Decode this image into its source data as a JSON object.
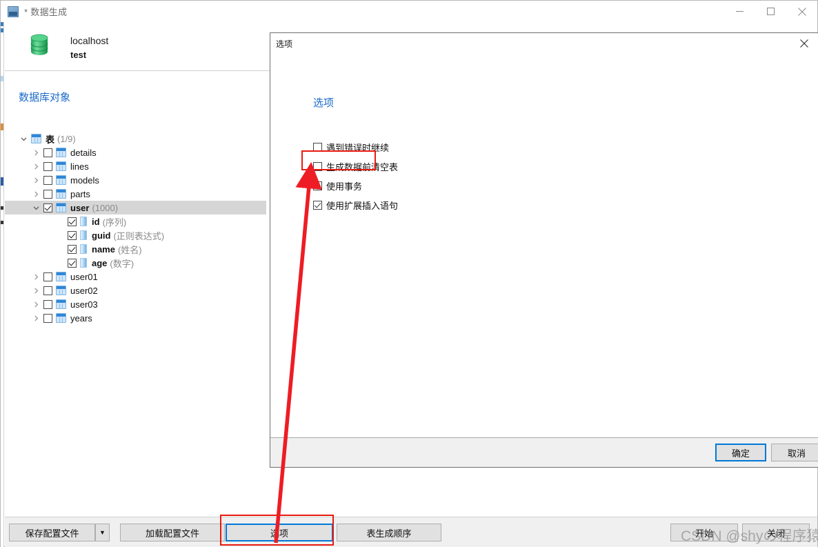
{
  "window": {
    "title": "* 数据生成",
    "icon": "database-generate-icon",
    "controls": {
      "minimize": "minimize-icon",
      "maximize": "maximize-icon",
      "close": "close-icon"
    }
  },
  "connection": {
    "host": "localhost",
    "database": "test",
    "icon": "database-cylinder-icon"
  },
  "objects_panel": {
    "title": "数据库对象",
    "tree": [
      {
        "label": "表",
        "meta": "(1/9)",
        "level": 0,
        "expander": "chevron-down",
        "checkbox": "none",
        "icon": "table-group-icon",
        "bold": true,
        "selected": false
      },
      {
        "label": "details",
        "meta": "",
        "level": 1,
        "expander": "chevron-right",
        "checkbox": "unchecked",
        "icon": "table-icon",
        "bold": false,
        "selected": false
      },
      {
        "label": "lines",
        "meta": "",
        "level": 1,
        "expander": "chevron-right",
        "checkbox": "unchecked",
        "icon": "table-icon",
        "bold": false,
        "selected": false
      },
      {
        "label": "models",
        "meta": "",
        "level": 1,
        "expander": "chevron-right",
        "checkbox": "unchecked",
        "icon": "table-icon",
        "bold": false,
        "selected": false
      },
      {
        "label": "parts",
        "meta": "",
        "level": 1,
        "expander": "chevron-right",
        "checkbox": "unchecked",
        "icon": "table-icon",
        "bold": false,
        "selected": false
      },
      {
        "label": "user",
        "meta": "(1000)",
        "level": 1,
        "expander": "chevron-down",
        "checkbox": "checked",
        "icon": "table-icon",
        "bold": true,
        "selected": true
      },
      {
        "label": "id",
        "meta": "(序列)",
        "level": 2,
        "expander": "none",
        "checkbox": "checked",
        "icon": "column-icon",
        "bold": true,
        "selected": false
      },
      {
        "label": "guid",
        "meta": "(正则表达式)",
        "level": 2,
        "expander": "none",
        "checkbox": "checked",
        "icon": "column-icon",
        "bold": true,
        "selected": false
      },
      {
        "label": "name",
        "meta": "(姓名)",
        "level": 2,
        "expander": "none",
        "checkbox": "checked",
        "icon": "column-icon",
        "bold": true,
        "selected": false
      },
      {
        "label": "age",
        "meta": "(数字)",
        "level": 2,
        "expander": "none",
        "checkbox": "checked",
        "icon": "column-icon",
        "bold": true,
        "selected": false
      },
      {
        "label": "user01",
        "meta": "",
        "level": 1,
        "expander": "chevron-right",
        "checkbox": "unchecked",
        "icon": "table-icon",
        "bold": false,
        "selected": false
      },
      {
        "label": "user02",
        "meta": "",
        "level": 1,
        "expander": "chevron-right",
        "checkbox": "unchecked",
        "icon": "table-icon",
        "bold": false,
        "selected": false
      },
      {
        "label": "user03",
        "meta": "",
        "level": 1,
        "expander": "chevron-right",
        "checkbox": "unchecked",
        "icon": "table-icon",
        "bold": false,
        "selected": false
      },
      {
        "label": "years",
        "meta": "",
        "level": 1,
        "expander": "chevron-right",
        "checkbox": "unchecked",
        "icon": "table-icon",
        "bold": false,
        "selected": false
      }
    ]
  },
  "bottom_toolbar": {
    "save_profile": "保存配置文件",
    "save_profile_dropdown": "▼",
    "load_profile": "加载配置文件",
    "options": "选项",
    "table_order": "表生成顺序",
    "start": "开始",
    "close": "关闭"
  },
  "dialog": {
    "titlebar": "选项",
    "close_icon": "close-icon",
    "heading": "选项",
    "options": [
      {
        "label": "遇到错误时继续",
        "checked": false,
        "highlighted": false
      },
      {
        "label": "生成数据前清空表",
        "checked": false,
        "highlighted": false
      },
      {
        "label": "使用事务",
        "checked": false,
        "highlighted": true
      },
      {
        "label": "使用扩展插入语句",
        "checked": true,
        "highlighted": false
      }
    ],
    "ok": "确定",
    "cancel": "取消"
  },
  "annotations": {
    "watermark": "CSDN @shyの程序猿",
    "highlight_color": "#e8190f",
    "arrow_color": "#ee1c24",
    "focus_color": "#0078d7"
  }
}
